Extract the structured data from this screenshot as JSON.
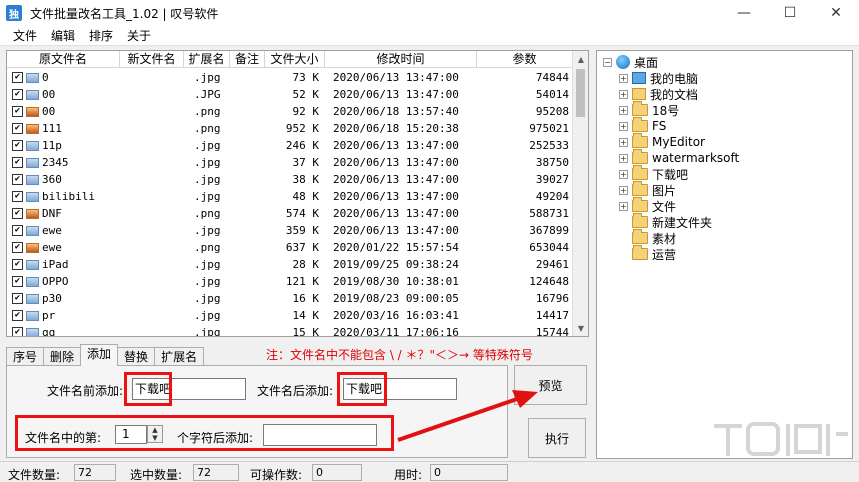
{
  "window": {
    "title": "文件批量改名工具_1.02 | 叹号软件",
    "app_icon_text": "独",
    "min_glyph": "—",
    "max_glyph": "☐",
    "close_glyph": "✕"
  },
  "menu": [
    "文件",
    "编辑",
    "排序",
    "关于"
  ],
  "list": {
    "headers": {
      "name": "原文件名",
      "new_name": "新文件名",
      "ext": "扩展名",
      "note": "备注",
      "size": "文件大小",
      "time": "修改时间",
      "param": "参数"
    },
    "rows": [
      {
        "name": "0",
        "ext": ".jpg",
        "size": "73  K",
        "time": "2020/06/13  13:47:00",
        "param": "74844",
        "icon": "jpg"
      },
      {
        "name": "00",
        "ext": ".JPG",
        "size": "52  K",
        "time": "2020/06/13  13:47:00",
        "param": "54014",
        "icon": "jpg"
      },
      {
        "name": "00",
        "ext": ".png",
        "size": "92  K",
        "time": "2020/06/18  13:57:40",
        "param": "95208",
        "icon": "png"
      },
      {
        "name": "111",
        "ext": ".png",
        "size": "952  K",
        "time": "2020/06/18  15:20:38",
        "param": "975021",
        "icon": "png"
      },
      {
        "name": "11p",
        "ext": ".jpg",
        "size": "246  K",
        "time": "2020/06/13  13:47:00",
        "param": "252533",
        "icon": "jpg"
      },
      {
        "name": "2345",
        "ext": ".jpg",
        "size": "37  K",
        "time": "2020/06/13  13:47:00",
        "param": "38750",
        "icon": "jpg"
      },
      {
        "name": "360",
        "ext": ".jpg",
        "size": "38  K",
        "time": "2020/06/13  13:47:00",
        "param": "39027",
        "icon": "jpg"
      },
      {
        "name": "bilibili",
        "ext": ".jpg",
        "size": "48  K",
        "time": "2020/06/13  13:47:00",
        "param": "49204",
        "icon": "jpg"
      },
      {
        "name": "DNF",
        "ext": ".png",
        "size": "574  K",
        "time": "2020/06/13  13:47:00",
        "param": "588731",
        "icon": "png"
      },
      {
        "name": "ewe",
        "ext": ".jpg",
        "size": "359  K",
        "time": "2020/06/13  13:47:00",
        "param": "367899",
        "icon": "jpg"
      },
      {
        "name": "ewe",
        "ext": ".png",
        "size": "637  K",
        "time": "2020/01/22  15:57:54",
        "param": "653044",
        "icon": "png"
      },
      {
        "name": "iPad",
        "ext": ".jpg",
        "size": "28  K",
        "time": "2019/09/25  09:38:24",
        "param": "29461",
        "icon": "jpg"
      },
      {
        "name": "OPPO",
        "ext": ".jpg",
        "size": "121  K",
        "time": "2019/08/30  10:38:01",
        "param": "124648",
        "icon": "jpg"
      },
      {
        "name": "p30",
        "ext": ".jpg",
        "size": "16  K",
        "time": "2019/08/23  09:00:05",
        "param": "16796",
        "icon": "jpg"
      },
      {
        "name": "pr",
        "ext": ".jpg",
        "size": "14  K",
        "time": "2020/03/16  16:03:41",
        "param": "14417",
        "icon": "jpg"
      },
      {
        "name": "qq",
        "ext": ".jpg",
        "size": "15  K",
        "time": "2020/03/11  17:06:16",
        "param": "15744",
        "icon": "jpg"
      }
    ]
  },
  "tree": {
    "root": "桌面",
    "items": [
      "我的电脑",
      "我的文档",
      "18号",
      "FS",
      "MyEditor",
      "watermarksoft",
      "下载吧",
      "图片",
      "文件",
      "新建文件夹",
      "素材",
      "运营"
    ]
  },
  "tabs": [
    "序号",
    "删除",
    "添加",
    "替换",
    "扩展名"
  ],
  "active_tab": "添加",
  "warning": "注：文件名中不能包含 \\ / ＊？\"＜＞→ 等特殊符号",
  "add_panel": {
    "prefix_label": "文件名前添加:",
    "prefix_value": "下载吧",
    "suffix_label": "文件名后添加:",
    "suffix_value": "下载吧",
    "nth_label": "文件名中的第:",
    "nth_value": "1",
    "after_label": "个字符后添加:",
    "after_value": ""
  },
  "buttons": {
    "preview": "预览",
    "execute": "执行"
  },
  "status": {
    "file_count_label": "文件数量:",
    "file_count": "72",
    "selected_label": "选中数量:",
    "selected": "72",
    "operable_label": "可操作数:",
    "operable": "0",
    "time_label": "用时:",
    "time": "0"
  },
  "colors": {
    "highlight": "#e11111",
    "warning_text": "#e00000"
  }
}
